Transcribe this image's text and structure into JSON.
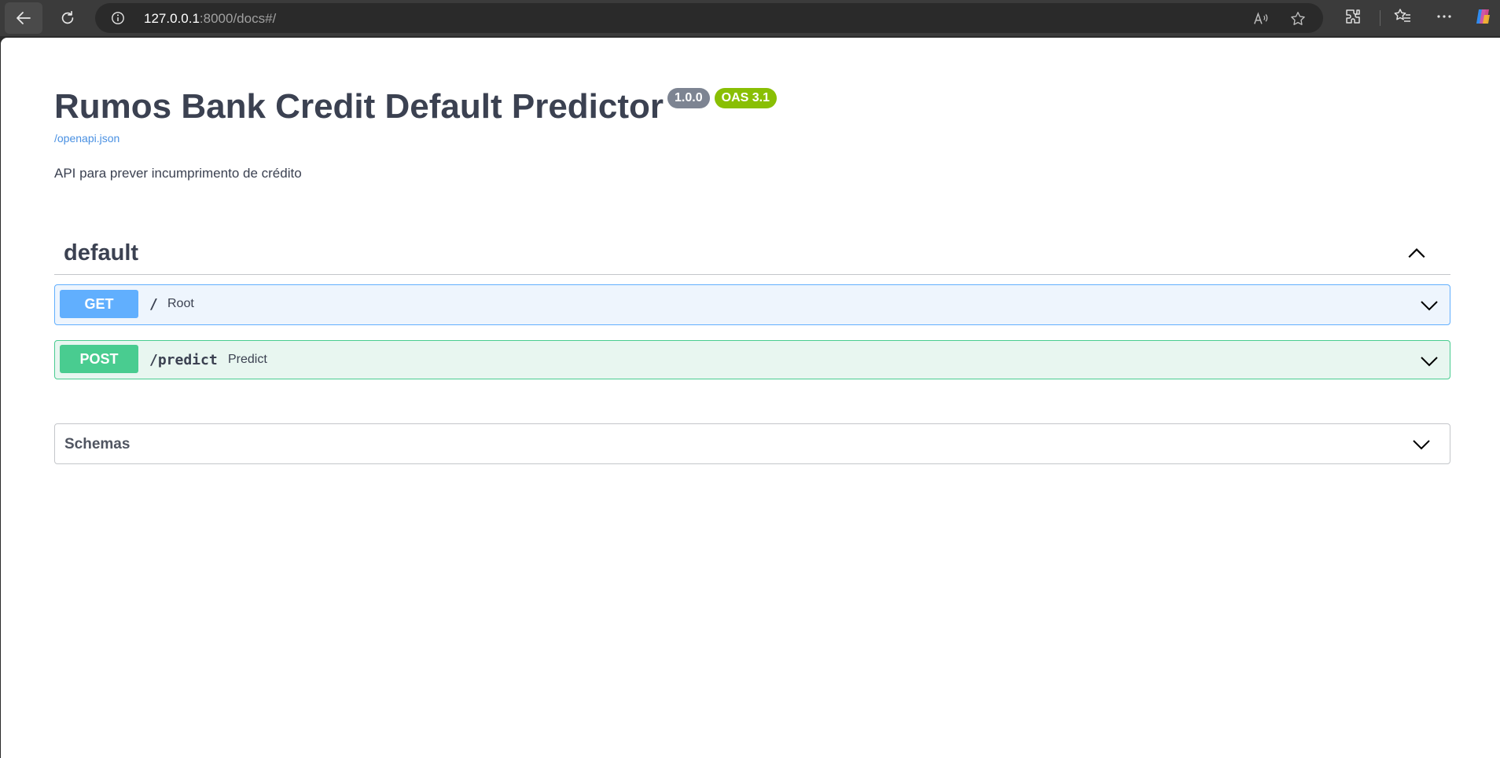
{
  "browser": {
    "url_host": "127.0.0.1",
    "url_rest": ":8000/docs#/",
    "icons": [
      "back-arrow-icon",
      "reload-icon",
      "site-info-icon",
      "read-aloud-icon",
      "favorite-star-icon",
      "extensions-icon",
      "favorites-icon",
      "more-icon",
      "copilot-icon"
    ]
  },
  "api": {
    "title": "Rumos Bank Credit Default Predictor",
    "version": "1.0.0",
    "oas": "OAS 3.1",
    "spec_link": "/openapi.json",
    "description": "API para prever incumprimento de crédito"
  },
  "tag": {
    "name": "default",
    "operations": [
      {
        "method": "GET",
        "path": "/",
        "summary": "Root"
      },
      {
        "method": "POST",
        "path": "/predict",
        "summary": "Predict"
      }
    ]
  },
  "schemas": {
    "label": "Schemas"
  },
  "colors": {
    "get": "#61affe",
    "post": "#49cc90",
    "version_badge": "#7d8492",
    "oas_badge": "#89bf04",
    "text": "#3b4151",
    "link": "#4990e2"
  }
}
